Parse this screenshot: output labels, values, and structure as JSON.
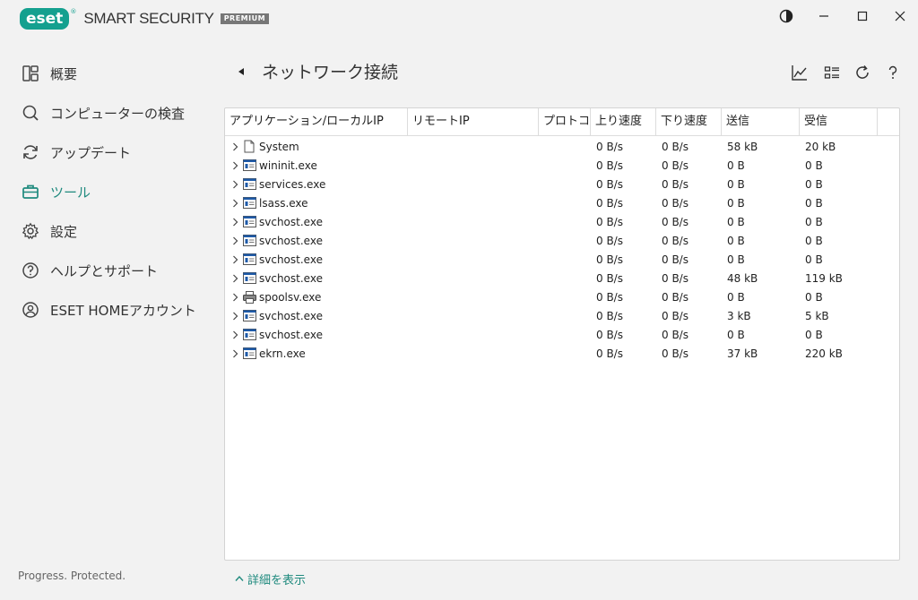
{
  "app": {
    "logo_text": "eset",
    "logo_reg": "®",
    "product": "SMART SECURITY",
    "edition": "PREMIUM"
  },
  "window_controls": [
    "theme-toggle",
    "minimize",
    "maximize",
    "close"
  ],
  "sidebar": {
    "items": [
      {
        "label": "概要",
        "icon": "overview-icon",
        "active": false
      },
      {
        "label": "コンピューターの検査",
        "icon": "search-icon",
        "active": false
      },
      {
        "label": "アップデート",
        "icon": "refresh-icon",
        "active": false
      },
      {
        "label": "ツール",
        "icon": "briefcase-icon",
        "active": true
      },
      {
        "label": "設定",
        "icon": "gear-icon",
        "active": false
      },
      {
        "label": "ヘルプとサポート",
        "icon": "help-icon",
        "active": false
      },
      {
        "label": "ESET HOMEアカウント",
        "icon": "account-icon",
        "active": false
      }
    ],
    "status": "Progress. Protected."
  },
  "header": {
    "title": "ネットワーク接続"
  },
  "toolbar": [
    "chart-icon",
    "list-view-icon",
    "refresh-icon",
    "help-icon"
  ],
  "table": {
    "columns": [
      "アプリケーション/ローカルIP",
      "リモートIP",
      "プロトコル",
      "上り速度",
      "下り速度",
      "送信",
      "受信"
    ],
    "rows": [
      {
        "name": "System",
        "icon": "file",
        "up": "0 B/s",
        "down": "0 B/s",
        "sent": "58 kB",
        "recv": "20 kB"
      },
      {
        "name": "wininit.exe",
        "icon": "window",
        "up": "0 B/s",
        "down": "0 B/s",
        "sent": "0 B",
        "recv": "0 B"
      },
      {
        "name": "services.exe",
        "icon": "window",
        "up": "0 B/s",
        "down": "0 B/s",
        "sent": "0 B",
        "recv": "0 B"
      },
      {
        "name": "lsass.exe",
        "icon": "window",
        "up": "0 B/s",
        "down": "0 B/s",
        "sent": "0 B",
        "recv": "0 B"
      },
      {
        "name": "svchost.exe",
        "icon": "window",
        "up": "0 B/s",
        "down": "0 B/s",
        "sent": "0 B",
        "recv": "0 B"
      },
      {
        "name": "svchost.exe",
        "icon": "window",
        "up": "0 B/s",
        "down": "0 B/s",
        "sent": "0 B",
        "recv": "0 B"
      },
      {
        "name": "svchost.exe",
        "icon": "window",
        "up": "0 B/s",
        "down": "0 B/s",
        "sent": "0 B",
        "recv": "0 B"
      },
      {
        "name": "svchost.exe",
        "icon": "window",
        "up": "0 B/s",
        "down": "0 B/s",
        "sent": "48 kB",
        "recv": "119 kB"
      },
      {
        "name": "spoolsv.exe",
        "icon": "printer",
        "up": "0 B/s",
        "down": "0 B/s",
        "sent": "0 B",
        "recv": "0 B"
      },
      {
        "name": "svchost.exe",
        "icon": "window",
        "up": "0 B/s",
        "down": "0 B/s",
        "sent": "3 kB",
        "recv": "5 kB"
      },
      {
        "name": "svchost.exe",
        "icon": "window",
        "up": "0 B/s",
        "down": "0 B/s",
        "sent": "0 B",
        "recv": "0 B"
      },
      {
        "name": "ekrn.exe",
        "icon": "window",
        "up": "0 B/s",
        "down": "0 B/s",
        "sent": "37 kB",
        "recv": "220 kB"
      }
    ]
  },
  "footer": {
    "details_link": "詳細を表示"
  },
  "colors": {
    "accent": "#1f8a7e",
    "brand": "#14a08f"
  }
}
